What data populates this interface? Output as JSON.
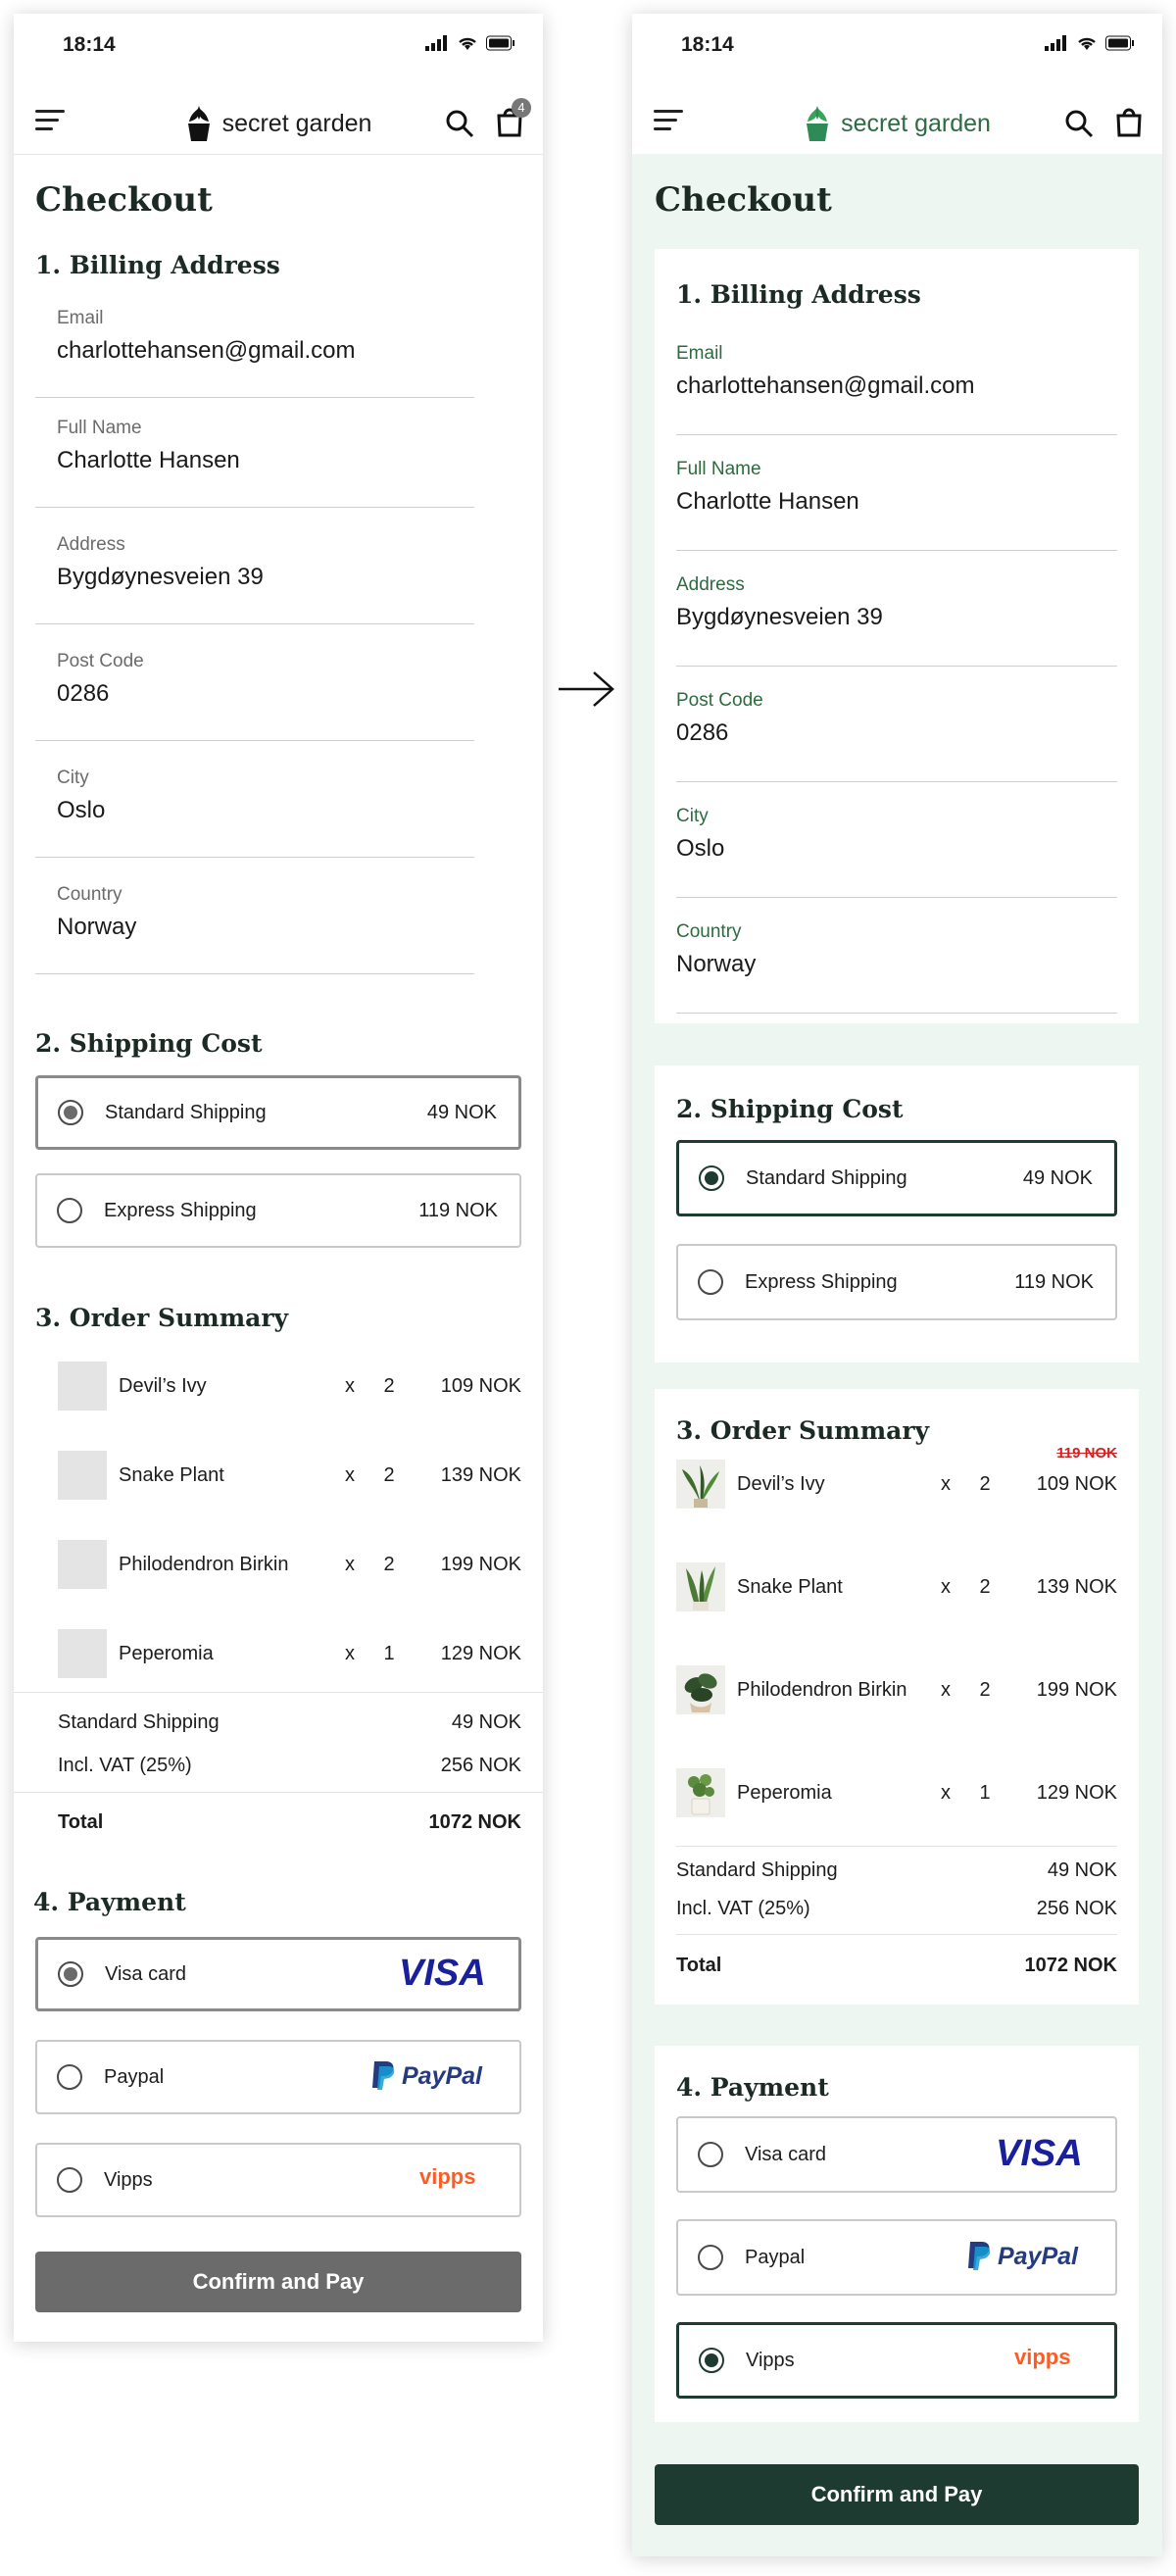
{
  "status": {
    "time": "18:14"
  },
  "brand": {
    "name": "secret garden",
    "cart_count": "4"
  },
  "page_title": "Checkout",
  "billing": {
    "heading": "1. Billing Address",
    "fields": [
      {
        "label": "Email",
        "value": "charlottehansen@gmail.com"
      },
      {
        "label": "Full Name",
        "value": "Charlotte Hansen"
      },
      {
        "label": "Address",
        "value": "Bygdøynesveien 39"
      },
      {
        "label": "Post Code",
        "value": "0286"
      },
      {
        "label": "City",
        "value": "Oslo"
      },
      {
        "label": "Country",
        "value": "Norway"
      }
    ]
  },
  "shipping": {
    "heading": "2. Shipping Cost",
    "options": [
      {
        "label": "Standard Shipping",
        "price": "49 NOK"
      },
      {
        "label": "Express Shipping",
        "price": "119 NOK"
      }
    ]
  },
  "summary": {
    "heading": "3. Order Summary",
    "items": [
      {
        "name": "Devil’s Ivy",
        "x": "x",
        "qty": "2",
        "price": "109 NOK",
        "old_price": "119 NOK"
      },
      {
        "name": "Snake Plant",
        "x": "x",
        "qty": "2",
        "price": "139 NOK"
      },
      {
        "name": "Philodendron Birkin",
        "x": "x",
        "qty": "2",
        "price": "199 NOK"
      },
      {
        "name": "Peperomia",
        "x": "x",
        "qty": "1",
        "price": "129 NOK"
      }
    ],
    "shipping_label": "Standard Shipping",
    "shipping_value": "49 NOK",
    "vat_label": "Incl. VAT (25%)",
    "vat_value": "256 NOK",
    "total_label": "Total",
    "total_value": "1072 NOK"
  },
  "payment": {
    "heading": "4. Payment",
    "options": [
      {
        "label": "Visa card",
        "logo_text": "VISA"
      },
      {
        "label": "Paypal",
        "logo_text": "PayPal"
      },
      {
        "label": "Vipps",
        "logo_text": "vipps"
      }
    ]
  },
  "confirm_label": "Confirm and Pay",
  "colors": {
    "brand_green": "#2e8b57",
    "dark_green": "#1e3b31",
    "label_green": "#2d6b3f",
    "bg_green": "#eef6f1",
    "grey_button": "#6b6b6b",
    "strike_red": "#d22020",
    "visa_blue": "#1a1f9c",
    "paypal_blue": "#253b80",
    "vipps_orange": "#ff5b24"
  }
}
